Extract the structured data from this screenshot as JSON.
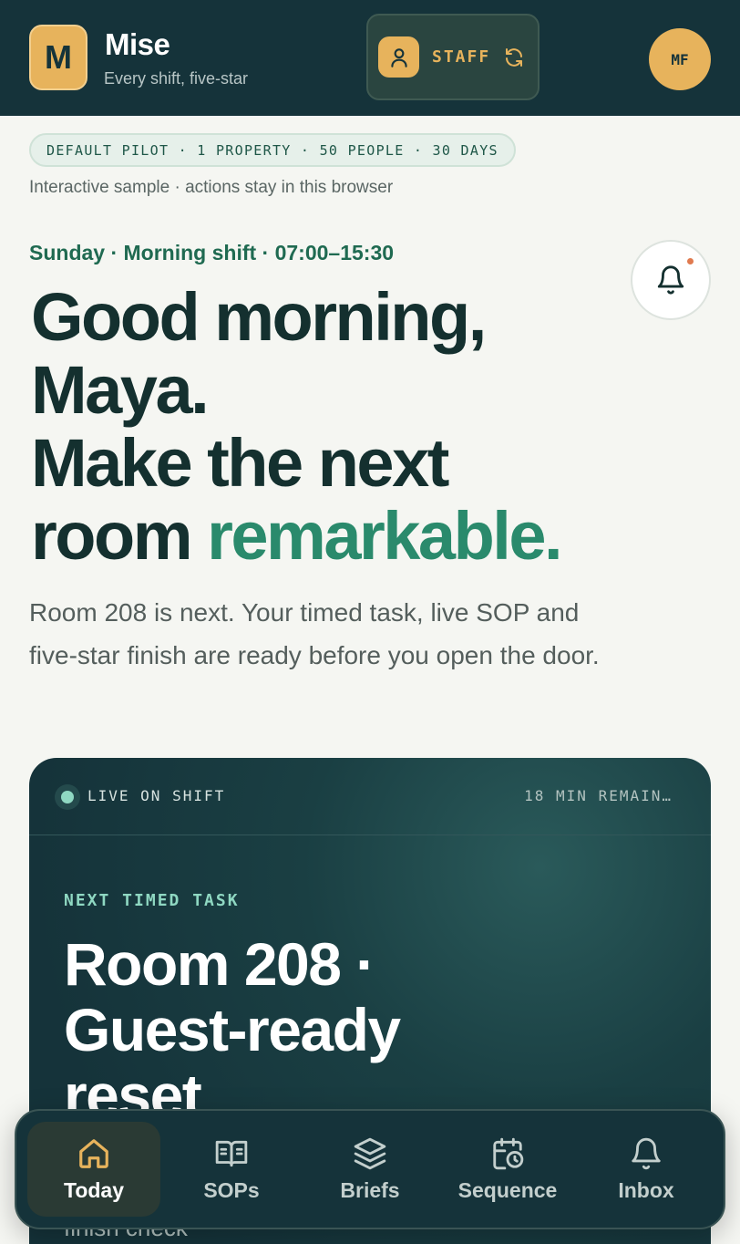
{
  "header": {
    "logo_letter": "M",
    "brand_name": "Mise",
    "brand_tagline": "Every shift, five-star",
    "role_label": "STAFF",
    "user_initials": "MF"
  },
  "pilot": {
    "pill": "DEFAULT PILOT · 1 PROPERTY · 50 PEOPLE · 30 DAYS",
    "note": "Interactive sample · actions stay in this browser"
  },
  "greeting": {
    "shift": "Sunday · Morning shift · 07:00–15:30",
    "headline_line1": "Good morning,",
    "headline_line2": "Maya.",
    "headline_line3": "Make the next",
    "headline_line4_plain": "room ",
    "headline_line4_accent": "remarkable.",
    "intro": "Room 208 is next. Your timed task, live SOP and five-star finish are ready before you open the door."
  },
  "task_card": {
    "live_label": "LIVE ON SHIFT",
    "time_remaining": "18 MIN REMAIN…",
    "kicker": "NEXT TIMED TASK",
    "title": "Room 208 · Guest-ready reset",
    "subtitle": "finish check"
  },
  "nav": {
    "items": [
      {
        "label": "Today",
        "icon": "home-icon",
        "active": true
      },
      {
        "label": "SOPs",
        "icon": "book-icon",
        "active": false
      },
      {
        "label": "Briefs",
        "icon": "layers-icon",
        "active": false
      },
      {
        "label": "Sequence",
        "icon": "calendar-clock-icon",
        "active": false
      },
      {
        "label": "Inbox",
        "icon": "bell-icon",
        "active": false
      }
    ]
  },
  "colors": {
    "header_bg": "#15333a",
    "brand_gold": "#e7b35c",
    "accent_green": "#2a8a6c",
    "page_bg": "#f5f6f2"
  }
}
